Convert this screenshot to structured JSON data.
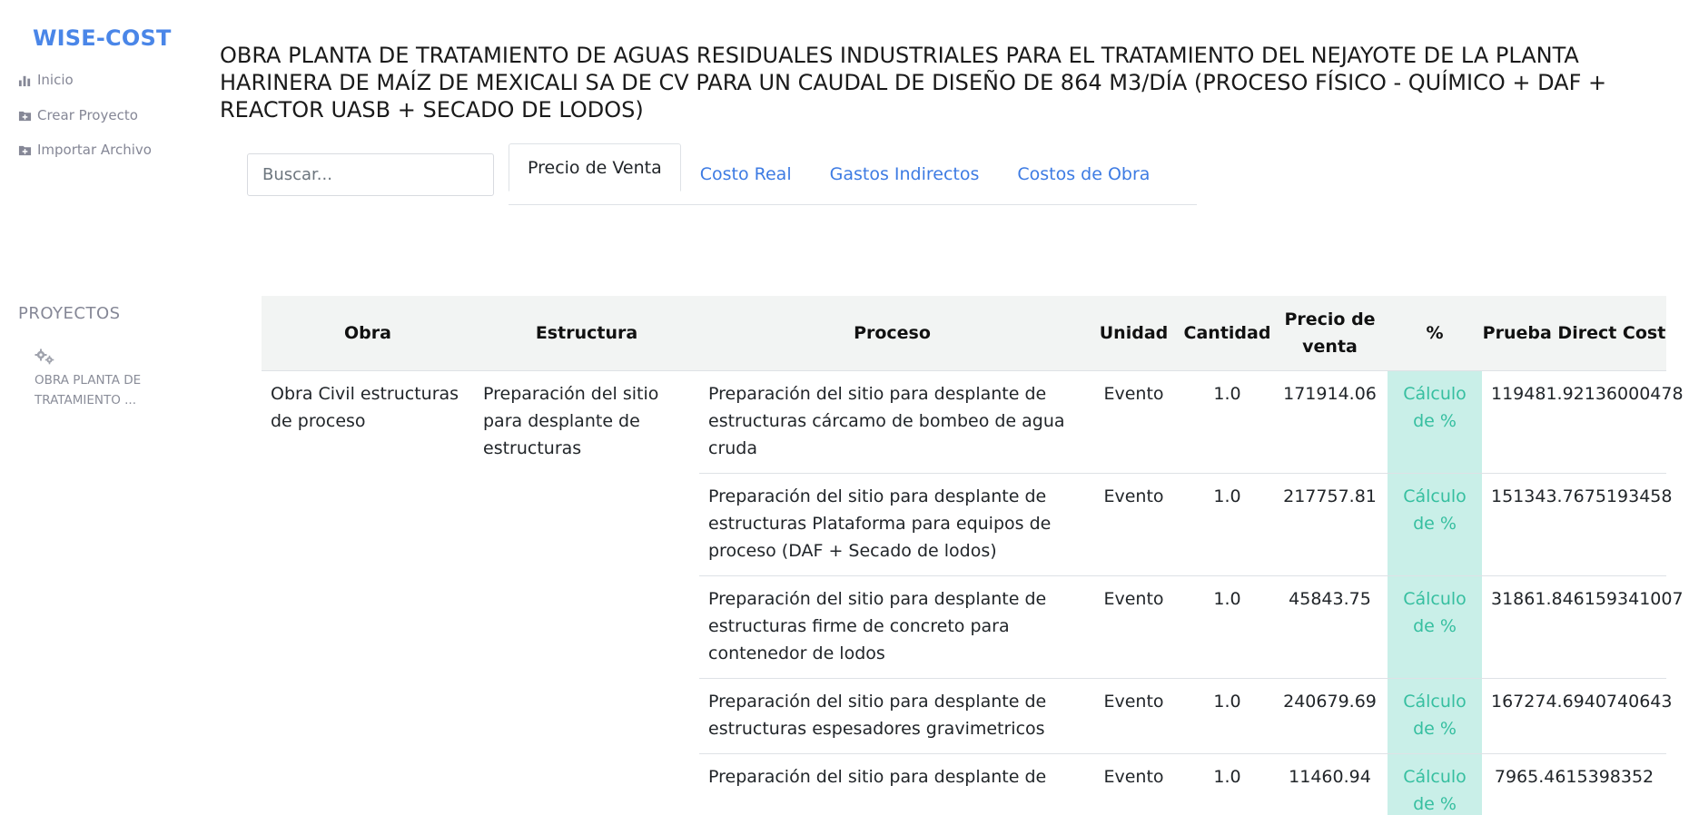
{
  "sidebar": {
    "brand": "WISE-COST",
    "nav": [
      {
        "label": "Inicio",
        "icon": "bar-chart-icon"
      },
      {
        "label": "Crear Proyecto",
        "icon": "folder-plus-icon"
      },
      {
        "label": "Importar Archivo",
        "icon": "folder-plus-icon"
      }
    ],
    "section_label": "PROYECTOS",
    "project": {
      "name": "OBRA PLANTA DE TRATAMIENTO ...",
      "icon": "gears-icon"
    }
  },
  "main": {
    "title": "OBRA PLANTA DE TRATAMIENTO DE AGUAS RESIDUALES INDUSTRIALES PARA EL TRATAMIENTO DEL NEJAYOTE DE LA PLANTA HARINERA DE MAÍZ DE MEXICALI SA DE CV PARA UN CAUDAL DE DISEÑO DE 864 M3/DÍA (PROCESO FÍSICO - QUÍMICO + DAF + REACTOR UASB + SECADO DE LODOS)",
    "search": {
      "placeholder": "Buscar...",
      "value": ""
    },
    "tabs": [
      {
        "label": "Precio de Venta",
        "active": true
      },
      {
        "label": "Costo Real",
        "active": false
      },
      {
        "label": "Gastos Indirectos",
        "active": false
      },
      {
        "label": "Costos de Obra",
        "active": false
      }
    ]
  },
  "table": {
    "headers": {
      "obra": "Obra",
      "estructura": "Estructura",
      "proceso": "Proceso",
      "unidad": "Unidad",
      "cantidad": "Cantidad",
      "precio_line1": "Precio de",
      "precio_line2": "venta",
      "pct": "%",
      "prueba": "Prueba Direct Cost"
    },
    "obra": "Obra Civil estructuras de proceso",
    "estructura": "Preparación del sitio para desplante de estructuras",
    "rows": [
      {
        "proceso": "Preparación del sitio para desplante de estructuras cárcamo de bombeo de agua cruda",
        "unidad": "Evento",
        "cantidad": "1.0",
        "precio": "171914.06",
        "pct": "Cálculo de %",
        "prueba": "119481.92136000478"
      },
      {
        "proceso": "Preparación del sitio para desplante de estructuras Plataforma para equipos de proceso (DAF + Secado de lodos)",
        "unidad": "Evento",
        "cantidad": "1.0",
        "precio": "217757.81",
        "pct": "Cálculo de %",
        "prueba": "151343.7675193458"
      },
      {
        "proceso": "Preparación del sitio para desplante de estructuras firme de concreto para contenedor de lodos",
        "unidad": "Evento",
        "cantidad": "1.0",
        "precio": "45843.75",
        "pct": "Cálculo de %",
        "prueba": "31861.846159341007"
      },
      {
        "proceso": "Preparación del sitio para desplante de estructuras espesadores gravimetricos",
        "unidad": "Evento",
        "cantidad": "1.0",
        "precio": "240679.69",
        "pct": "Cálculo de %",
        "prueba": "167274.6940740643"
      },
      {
        "proceso": "Preparación del sitio para desplante de",
        "unidad": "Evento",
        "cantidad": "1.0",
        "precio": "11460.94",
        "pct": "Cálculo de %",
        "prueba": "7965.4615398352"
      }
    ]
  },
  "colors": {
    "brand": "#4a86e8",
    "link": "#3d7be3",
    "pct_bg": "#c9efe8",
    "pct_text": "#36bfa0",
    "header_bg": "#f2f4f3"
  }
}
